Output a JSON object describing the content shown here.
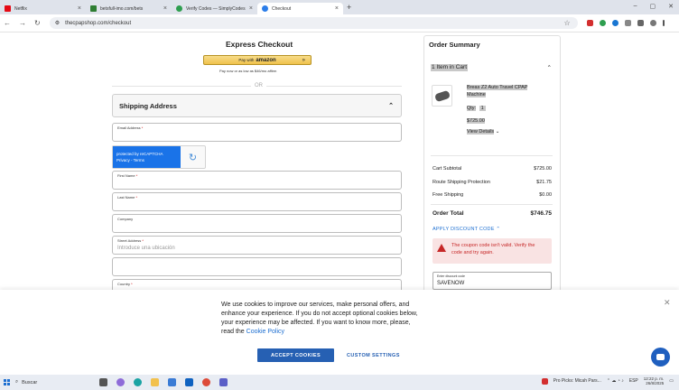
{
  "browser": {
    "tabs": [
      {
        "title": "Netflix",
        "color": "#e50914",
        "active": false
      },
      {
        "title": "betsfull-imo.com/bets",
        "color": "#2e7d32",
        "active": false
      },
      {
        "title": "Verify Codes — SimplyCodes",
        "color": "#2e9e4f",
        "active": false
      },
      {
        "title": "Checkout",
        "color": "#2b7de9",
        "active": true
      }
    ],
    "url": "thecpapshop.com/checkout",
    "new_tab": "+"
  },
  "checkout": {
    "express_title": "Express Checkout",
    "amazon_pay_prefix": "Pay with",
    "amazon_pay_brand": "amazon",
    "affirm_text": "Pay now or as low as $46/mo affirm",
    "or_text": "OR",
    "shipping_title": "Shipping Address",
    "fields": {
      "email": "Email Address",
      "first_name": "First Name",
      "last_name": "Last Name",
      "company": "Company",
      "street": "Street Address",
      "street_placeholder": "Introduce una ubicación",
      "country": "Country"
    },
    "required_mark": "*",
    "recaptcha_line1": "protected by reCAPTCHA",
    "recaptcha_line2": "Privacy - Terms"
  },
  "summary": {
    "title": "Order Summary",
    "cart_count": "1 Item in Cart",
    "product_name_line1": "Breas Z2 Auto Travel CPAP",
    "product_name_line2": "Machine",
    "qty_label": "Qty:",
    "qty_value": "1",
    "product_price": "$725.00",
    "view_details": "View Details",
    "rows": [
      {
        "label": "Cart Subtotal",
        "value": "$725.00"
      },
      {
        "label": "Route Shipping Protection",
        "value": "$21.75"
      },
      {
        "label": "Free Shipping",
        "value": "$0.00"
      }
    ],
    "order_total_label": "Order Total",
    "order_total_value": "$746.75",
    "apply_discount": "APPLY DISCOUNT CODE",
    "error_line1": "The coupon code isn't valid. Verify the",
    "error_line2": "code and try again.",
    "discount_label": "Enter discount code",
    "discount_value": "SAVENOW"
  },
  "cookie": {
    "line1": "We use cookies to improve our services, make personal offers, and",
    "line2": "enhance your experience. If you do not accept optional cookies below,",
    "line3": "your experience may be affected. If you want to know more, please,",
    "line4_prefix": "read the",
    "policy_link": "Cookie Policy",
    "accept": "ACCEPT COOKIES",
    "custom": "CUSTOM SETTINGS"
  },
  "taskbar": {
    "search": "Buscar",
    "news": "Pro Picks: Micah Pars...",
    "lang": "ESP",
    "time": "12:22 p. m.",
    "date": "26/8/2025"
  },
  "colors": {
    "accent": "#2660b3",
    "error": "#c62828",
    "link": "#1d6fd1"
  }
}
